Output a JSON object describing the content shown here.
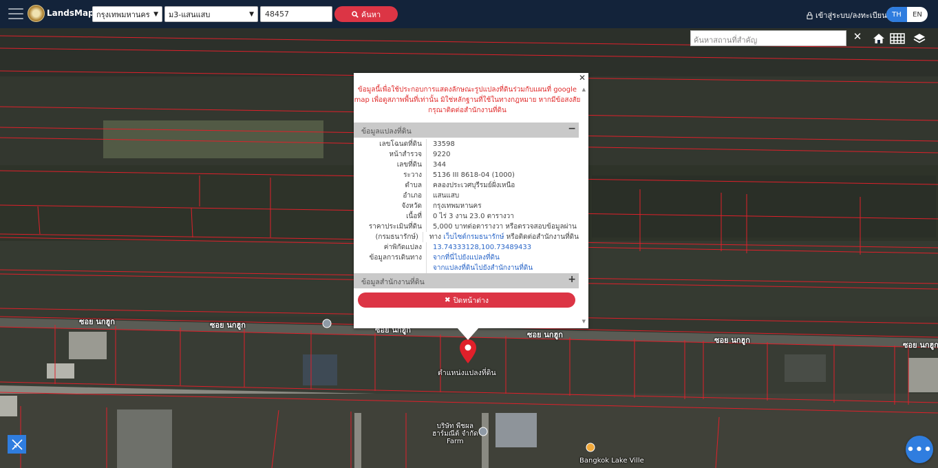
{
  "header": {
    "brand": "LandsMaps",
    "province_select": "กรุงเทพมหานคร",
    "district_select": "ม3-แสนแสบ",
    "parcel_input": "48457",
    "search_button": "ค้นหา",
    "login_link": "เข้าสู่ระบบ/ลงทะเบียน",
    "lang_th": "TH",
    "lang_en": "EN"
  },
  "map_toolbar": {
    "place_search_placeholder": "ค้นหาสถานที่สำคัญ",
    "clear_icon": "close-icon",
    "home_icon": "home-icon",
    "grid_icon": "grid-icon",
    "layers_icon": "layers-icon"
  },
  "map": {
    "road_labels": [
      "ซอย นกฮูก",
      "ซอย นกฮูก",
      "ซอย นกฮูก",
      "ซอย นกฮูก",
      "ซอย นกฮูก",
      "ซอย นกฮูก"
    ],
    "poi_1": "บริษัท พืชผล\nฮาร์มณีต้ จำกัด\nFarm",
    "poi_2": "Bangkok Lake Ville",
    "pin_label": "ตำแหน่งแปลงที่ดิน"
  },
  "popup": {
    "notice": "ข้อมูลนี้เพื่อใช้ประกอบการแสดงลักษณะรูปแปลงที่ดินร่วมกับแผนที่ google map เพื่อดูสภาพพื้นที่เท่านั้น มิใช่หลักฐานที่ใช้ในทางกฎหมาย หากมีข้อสงสัย กรุณาติดต่อสำนักงานที่ดิน",
    "parcel_section": "ข้อมูลแปลงที่ดิน",
    "office_section": "ข้อมูลสำนักงานที่ดิน",
    "close_button": "ปิดหน้าต่าง",
    "rows": [
      {
        "k": "เลขโฉนดที่ดิน",
        "v": "33598"
      },
      {
        "k": "หน้าสำรวจ",
        "v": "9220"
      },
      {
        "k": "เลขที่ดิน",
        "v": "344"
      },
      {
        "k": "ระวาง",
        "v": "5136 III 8618-04 (1000)"
      },
      {
        "k": "ตำบล",
        "v": "คลองประเวศบุรีรมย์ฝั่งเหนือ"
      },
      {
        "k": "อำเภอ",
        "v": "แสนแสบ"
      },
      {
        "k": "จังหวัด",
        "v": "กรุงเทพมหานคร"
      },
      {
        "k": "เนื้อที่",
        "v": "0 ไร่ 3 งาน 23.0 ตารางวา"
      },
      {
        "k": "ราคาประเมินที่ดิน",
        "v": "5,000 บาทต่อตารางวา หรือตรวจสอบข้อมูลผ่าน"
      },
      {
        "k": "(กรมธนารักษ์)",
        "v_pre": "ทาง ",
        "v_link": "เว็บไซต์กรมธนารักษ์",
        "v_post": " หรือติดต่อสำนักงานที่ดิน"
      },
      {
        "k": "ค่าพิกัดแปลง",
        "v": "13.74333128,100.73489433"
      },
      {
        "k": "ข้อมูลการเดินทาง",
        "v": "จากที่นี่ไปยังแปลงที่ดิน"
      },
      {
        "k": "",
        "v": "จากแปลงที่ดินไปยังสำนักงานที่ดิน"
      }
    ]
  },
  "colors": {
    "topbar": "#13233a",
    "accent_red": "#dc3545",
    "accent_blue": "#2f7ddf",
    "parcel_line": "#e0202a"
  }
}
